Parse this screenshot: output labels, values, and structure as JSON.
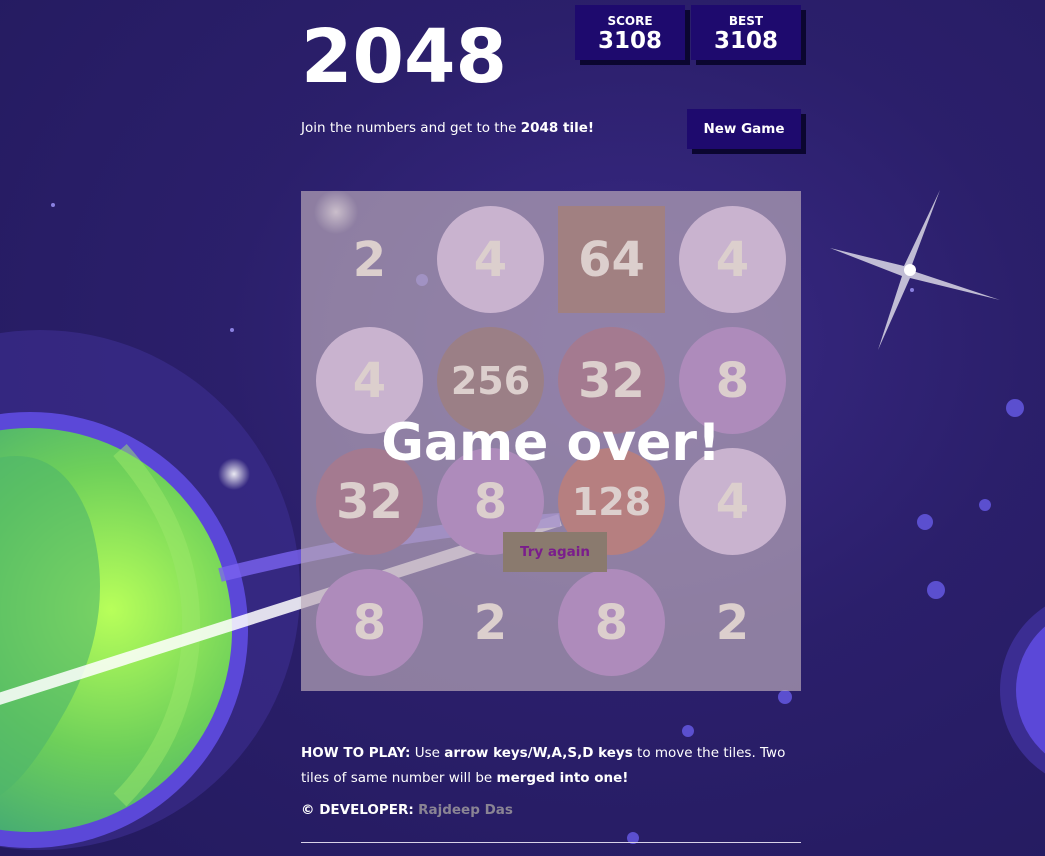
{
  "game": {
    "title": "2048",
    "score_label": "SCORE",
    "score_value": "3108",
    "best_label": "BEST",
    "best_value": "3108",
    "intro_prefix": "Join the numbers and get to the ",
    "intro_bold": "2048 tile!",
    "new_game_label": "New Game"
  },
  "board": {
    "tiles": [
      [
        "2",
        "4",
        "64",
        "4"
      ],
      [
        "4",
        "256",
        "32",
        "8"
      ],
      [
        "32",
        "8",
        "128",
        "4"
      ],
      [
        "8",
        "2",
        "8",
        "2"
      ]
    ],
    "tile_colors": {
      "2": "transparent",
      "4": "#dcc5e8",
      "8": "#b58ccc",
      "32": "#a7738f",
      "64": "#a37b79",
      "128": "#c07a78",
      "256": "#9a7a80"
    },
    "game_over_text": "Game over!",
    "try_again_label": "Try again"
  },
  "howto": {
    "prefix_bold": "HOW TO PLAY:",
    "text_1": " Use ",
    "bold_1": "arrow keys/W,A,S,D keys",
    "text_2": " to move the tiles. Two tiles of same number will be ",
    "bold_2": "merged into one!"
  },
  "developer": {
    "label": "© DEVELOPER:",
    "name": "Rajdeep Das"
  }
}
